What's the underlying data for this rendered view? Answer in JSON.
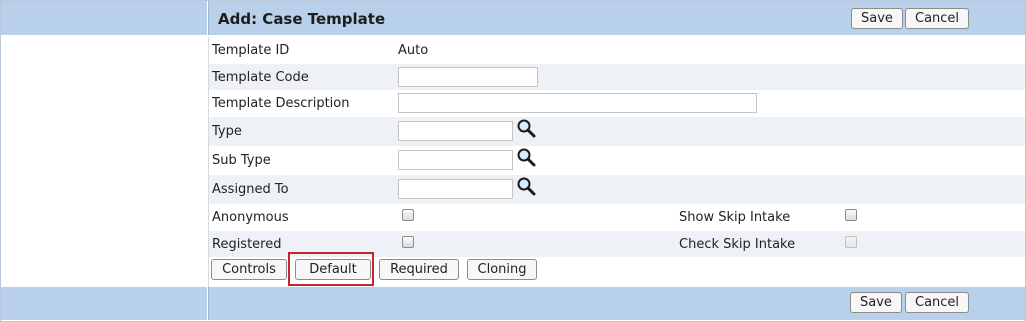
{
  "header": {
    "title": "Add: Case Template",
    "save_label": "Save",
    "cancel_label": "Cancel"
  },
  "fields": {
    "template_id": {
      "label": "Template ID",
      "value": "Auto"
    },
    "template_code": {
      "label": "Template Code",
      "value": ""
    },
    "template_description": {
      "label": "Template Description",
      "value": ""
    },
    "type": {
      "label": "Type",
      "value": ""
    },
    "sub_type": {
      "label": "Sub Type",
      "value": ""
    },
    "assigned_to": {
      "label": "Assigned To",
      "value": ""
    },
    "anonymous": {
      "label": "Anonymous",
      "checked": false
    },
    "registered": {
      "label": "Registered",
      "checked": false
    },
    "show_skip_intake": {
      "label": "Show Skip Intake",
      "checked": false
    },
    "check_skip_intake": {
      "label": "Check Skip Intake",
      "checked": false,
      "disabled": true
    }
  },
  "tabs": {
    "controls": "Controls",
    "default": "Default",
    "required": "Required",
    "cloning": "Cloning"
  },
  "footer": {
    "save_label": "Save",
    "cancel_label": "Cancel"
  },
  "colors": {
    "header_bg": "#b8d0ea",
    "alt_row_bg": "#eef2f6",
    "highlight": "#c0282d"
  }
}
